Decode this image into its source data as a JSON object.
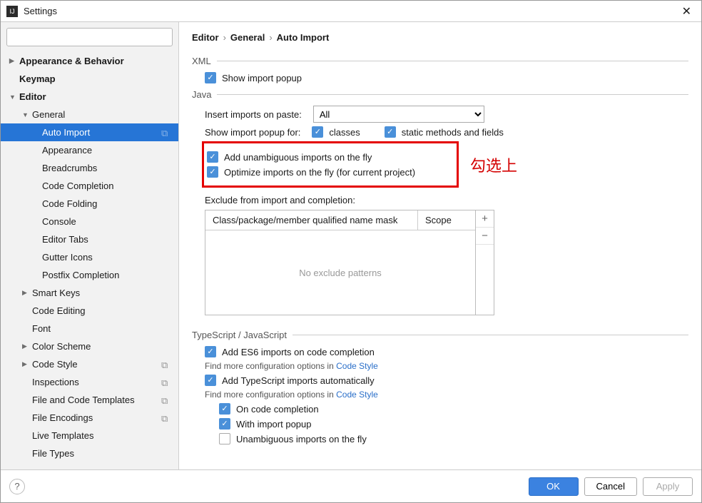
{
  "window": {
    "title": "Settings"
  },
  "search": {
    "placeholder": ""
  },
  "tree": {
    "appearance_behavior": "Appearance & Behavior",
    "keymap": "Keymap",
    "editor": "Editor",
    "general": "General",
    "auto_import": "Auto Import",
    "appearance": "Appearance",
    "breadcrumbs": "Breadcrumbs",
    "code_completion": "Code Completion",
    "code_folding": "Code Folding",
    "console": "Console",
    "editor_tabs": "Editor Tabs",
    "gutter_icons": "Gutter Icons",
    "postfix_completion": "Postfix Completion",
    "smart_keys": "Smart Keys",
    "code_editing": "Code Editing",
    "font": "Font",
    "color_scheme": "Color Scheme",
    "code_style": "Code Style",
    "inspections": "Inspections",
    "file_code_templates": "File and Code Templates",
    "file_encodings": "File Encodings",
    "live_templates": "Live Templates",
    "file_types": "File Types"
  },
  "breadcrumb": {
    "p1": "Editor",
    "p2": "General",
    "p3": "Auto Import",
    "sep": "›"
  },
  "sections": {
    "xml": "XML",
    "java": "Java",
    "ts_js": "TypeScript / JavaScript"
  },
  "xml": {
    "show_import_popup": "Show import popup"
  },
  "java": {
    "insert_on_paste_label": "Insert imports on paste:",
    "insert_on_paste_value": "All",
    "popup_for_label": "Show import popup for:",
    "classes": "classes",
    "static": "static methods and fields",
    "unambiguous": "Add unambiguous imports on the fly",
    "optimize": "Optimize imports on the fly (for current project)",
    "exclude_label": "Exclude from import and completion:",
    "col_mask": "Class/package/member qualified name mask",
    "col_scope": "Scope",
    "empty": "No exclude patterns"
  },
  "annotation": "勾选上",
  "tsjs": {
    "es6": "Add ES6 imports on code completion",
    "hint": "Find more configuration options in ",
    "hint_link": "Code Style",
    "auto_ts": "Add TypeScript imports automatically",
    "on_completion": "On code completion",
    "with_popup": "With import popup",
    "unambiguous": "Unambiguous imports on the fly"
  },
  "footer": {
    "ok": "OK",
    "cancel": "Cancel",
    "apply": "Apply"
  }
}
